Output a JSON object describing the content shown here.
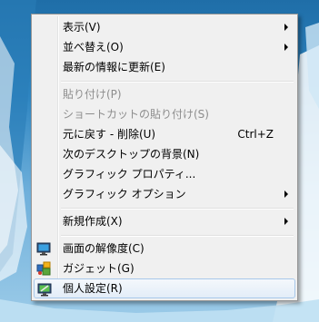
{
  "menu": {
    "items": [
      {
        "label": "表示(V)",
        "submenu": true
      },
      {
        "label": "並べ替え(O)",
        "submenu": true
      },
      {
        "label": "最新の情報に更新(E)"
      },
      {
        "label": "貼り付け(P)",
        "disabled": true
      },
      {
        "label": "ショートカットの貼り付け(S)",
        "disabled": true
      },
      {
        "label": "元に戻す - 削除(U)",
        "shortcut": "Ctrl+Z"
      },
      {
        "label": "次のデスクトップの背景(N)"
      },
      {
        "label": "グラフィック プロパティ..."
      },
      {
        "label": "グラフィック オプション",
        "submenu": true
      },
      {
        "label": "新規作成(X)",
        "submenu": true
      },
      {
        "label": "画面の解像度(C)",
        "icon": "monitor-icon"
      },
      {
        "label": "ガジェット(G)",
        "icon": "gadget-icon"
      },
      {
        "label": "個人設定(R)",
        "icon": "personalize-icon"
      }
    ]
  }
}
